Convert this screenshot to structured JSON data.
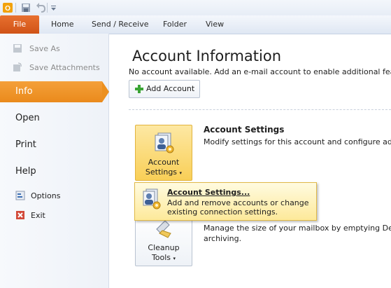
{
  "ribbon": {
    "file_tab": "File",
    "tabs": [
      "Home",
      "Send / Receive",
      "Folder",
      "View"
    ]
  },
  "backstage": {
    "commands": [
      "Save As",
      "Save Attachments"
    ],
    "nav": [
      "Info",
      "Open",
      "Print",
      "Help"
    ],
    "small": [
      "Options",
      "Exit"
    ]
  },
  "main": {
    "title": "Account Information",
    "message": "No account available. Add an e-mail account to enable additional featu",
    "add_account": "Add Account",
    "account_settings_btn": [
      "Account",
      "Settings"
    ],
    "account_settings_heading": "Account Settings",
    "account_settings_desc": "Modify settings for this account and configure add",
    "cleanup_btn": [
      "Cleanup",
      "Tools"
    ],
    "cleanup_desc": [
      "Manage the size of your mailbox by emptying Dele",
      "archiving."
    ]
  },
  "dropdown": {
    "title": "Account Settings...",
    "desc": "Add and remove accounts or change existing connection settings."
  },
  "colors": {
    "file_tab": "#d8581c",
    "selected_nav": "#ee9525",
    "highlight": "#fde99a"
  }
}
